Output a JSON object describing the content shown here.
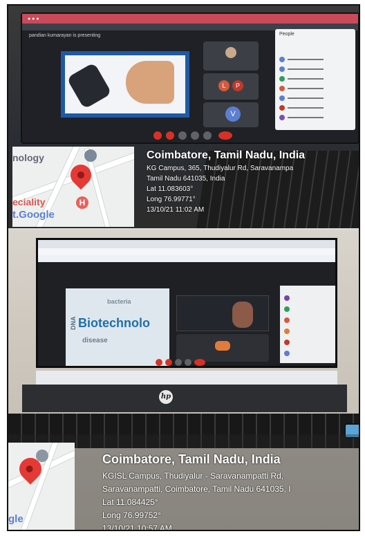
{
  "photo1": {
    "screen": {
      "presenting_text": "pandian kumarayan is presenting",
      "people_panel_title": "People",
      "participant_initials": [
        "L",
        "P",
        "V"
      ]
    },
    "map": {
      "label_top": "nology",
      "label_bottom_1": "eciality",
      "label_bottom_2": "t.Google",
      "hospital_letter": "H"
    },
    "caption": {
      "title": "Coimbatore, Tamil Nadu, India",
      "address_1": "KG Campus, 365, Thudiyalur Rd, Saravanampa",
      "address_2": "Tamil Nadu 641035, India",
      "lat": "Lat 11.083603°",
      "long": "Long 76.99771°",
      "datetime": "13/10/21 11:02 AM"
    }
  },
  "photo2": {
    "screen": {
      "slide_word": "Biotechnolo",
      "brand": "hp"
    },
    "map": {
      "label_bottom": "gle"
    },
    "caption": {
      "title": "Coimbatore, Tamil Nadu, India",
      "address_1": "KGISL Campus, Thudiyalur - Saravanampatti Rd,",
      "address_2": "Saravanampatti, Coimbatore, Tamil Nadu 641035, I",
      "lat": "Lat 11.084425°",
      "long": "Long 76.99752°",
      "datetime": "13/10/21 10:57 AM"
    }
  },
  "colors": {
    "pin": "#e53935",
    "meet_red": "#d93025",
    "chrome_tab": "#c94a5a",
    "slide_border": "#1f5aa6"
  }
}
